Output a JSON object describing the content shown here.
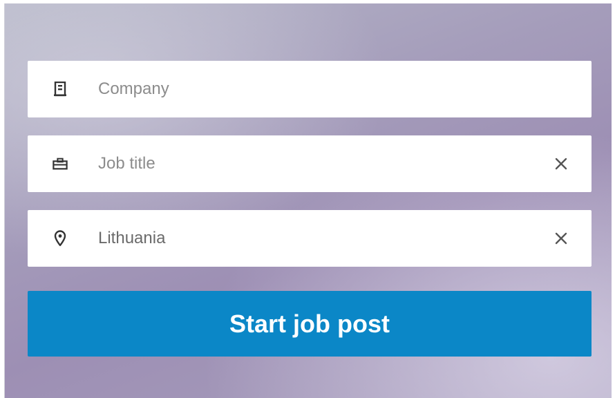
{
  "form": {
    "company": {
      "placeholder": "Company",
      "value": "",
      "icon": "building-icon"
    },
    "job_title": {
      "placeholder": "Job title",
      "value": "",
      "icon": "briefcase-icon",
      "has_clear": true
    },
    "location": {
      "placeholder": "",
      "value": "Lithuania",
      "icon": "location-pin-icon",
      "has_clear": true
    },
    "submit_label": "Start job post"
  },
  "colors": {
    "accent": "#0b87c7",
    "icon": "#333333",
    "placeholder_text": "#8c8c8c",
    "value_text": "#6a6a6a"
  }
}
